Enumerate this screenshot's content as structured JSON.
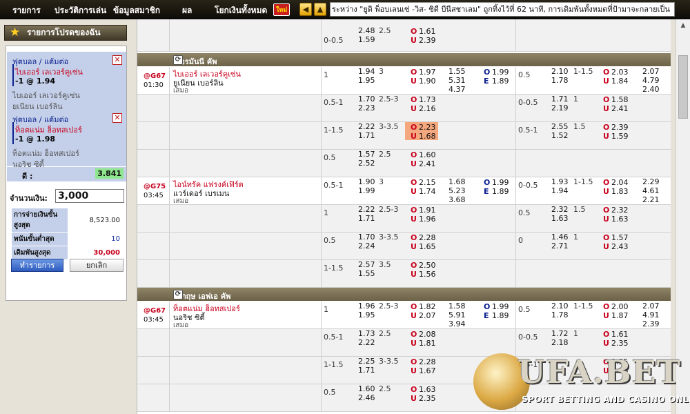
{
  "nav": {
    "items": [
      "รายการ",
      "ประวัติการเล่น",
      "ข้อมูลสมาชิก",
      "ผล",
      "โยกเงินทั้งหมด"
    ],
    "new_badge": "ใหม่",
    "marquee": "ระหว่าง \"ยูดิ พ็อบเลนเซ่ -วิส- ซิดี บีนีสชาเลม\" ถูกทิ้งไว้ที่ 62 นาที, การเดิมพันทั้งหมดที่ป้ามาจะกลายเป็น"
  },
  "slip": {
    "title": "รายการโปรดของฉัน",
    "bets": [
      {
        "type": "ฟุตบอล / แต้มต่อ",
        "pick": "ไบเออร์ เลเวอร์คูเซ่น",
        "line": "-1 @ 1.94",
        "home": "ไบเออร์ เลเวอร์คูเซ่น",
        "away": "ยูเนียน เบอร์ลิน"
      },
      {
        "type": "ฟุตบอล / แต้มต่อ",
        "pick": "ท็อตแน่ม ฮ็อทสเปอร์",
        "line": "-1 @ 1.98",
        "home": "ท็อตแน่ม ฮ็อทสเปอร์",
        "away": "นอริช ซิตี้"
      }
    ],
    "odds_label": "ดี :",
    "odds_value": "3.841",
    "stake_label": "จำนวนเงิน:",
    "stake_value": "3,000",
    "limits": [
      {
        "label": "การจ่ายเงินขั้นสูงสุด",
        "value": "8,523.00"
      },
      {
        "label": "พนันขั้นต่ำสุด",
        "value": "10"
      },
      {
        "label": "เดิมพันสูงสุด",
        "value": "30,000"
      }
    ],
    "place_label": "ทำรายการ",
    "cancel_label": "ยกเลิก"
  },
  "top_partial": {
    "hdp": "0-0.5",
    "h1": "2.48",
    "h2": "1.59",
    "ou": "2.5",
    "o": "1.61",
    "u": "2.39"
  },
  "leagues": [
    {
      "name": "เยอรมันนี คัพ",
      "matches": [
        {
          "code": "@G67",
          "time": "01:30",
          "home": "ไบเออร์ เลเวอร์คูเซ่น",
          "away": "ยูเนียน เบอร์ลิน",
          "draw": "เสมอ",
          "rows": [
            {
              "hdp": "1",
              "h1": "1.94",
              "h2": "1.95",
              "ou": "3",
              "o": "1.97",
              "u": "1.90",
              "x1": [
                "1.55",
                "5.31",
                "4.37"
              ],
              "oe": [
                "1.99",
                "1.89"
              ],
              "hhdp": "0.5",
              "hh1": "2.10",
              "hh2": "1.78",
              "hou": "1-1.5",
              "ho": "2.03",
              "hu": "1.84",
              "hx": [
                "2.07",
                "4.79",
                "2.40"
              ]
            },
            {
              "hdp": "0.5-1",
              "h1": "1.70",
              "h2": "2.23",
              "ou": "2.5-3",
              "o": "1.73",
              "u": "2.16",
              "hhdp": "0-0.5",
              "hh1": "1.71",
              "hh2": "2.19",
              "hou": "1",
              "ho": "1.58",
              "hu": "2.41"
            },
            {
              "hdp": "1-1.5",
              "h1": "2.22",
              "h2": "1.71",
              "ou": "3-3.5",
              "o": "2.23",
              "u": "1.68",
              "hl": true,
              "hhdp": "0.5-1",
              "hh1": "2.55",
              "hh2": "1.52",
              "hou": "1.5",
              "ho": "2.39",
              "hu": "1.59"
            },
            {
              "hdp": "0.5",
              "h1": "1.57",
              "h2": "2.52",
              "ou": "2.5",
              "o": "1.60",
              "u": "2.41"
            }
          ]
        },
        {
          "code": "@G75",
          "time": "03:45",
          "home": "ไอน์ทรัค แฟรงค์เฟิร์ต",
          "away": "แวร์เดอร์ เบรเมน",
          "draw": "เสมอ",
          "rows": [
            {
              "hdp": "0.5-1",
              "h1": "1.90",
              "h2": "1.99",
              "ou": "3",
              "o": "2.15",
              "u": "1.74",
              "x1": [
                "1.68",
                "5.23",
                "3.68"
              ],
              "oe": [
                "1.99",
                "1.89"
              ],
              "hhdp": "0-0.5",
              "hh1": "1.93",
              "hh2": "1.94",
              "hou": "1-1.5",
              "ho": "2.04",
              "hu": "1.83",
              "hx": [
                "2.29",
                "4.61",
                "2.21"
              ]
            },
            {
              "hdp": "1",
              "h1": "2.22",
              "h2": "1.71",
              "ou": "2.5-3",
              "o": "1.91",
              "u": "1.96",
              "hhdp": "0.5",
              "hh1": "2.32",
              "hh2": "1.63",
              "hou": "1.5",
              "ho": "2.32",
              "hu": "1.63"
            },
            {
              "hdp": "0.5",
              "h1": "1.70",
              "h2": "2.24",
              "ou": "3-3.5",
              "o": "2.28",
              "u": "1.65",
              "hhdp": "0",
              "hh1": "1.46",
              "hh2": "2.71",
              "hou": "1",
              "ho": "1.57",
              "hu": "2.43"
            },
            {
              "hdp": "1-1.5",
              "h1": "2.57",
              "h2": "1.55",
              "ou": "3.5",
              "o": "2.50",
              "u": "1.56"
            }
          ]
        }
      ]
    },
    {
      "name": "อังกฤษ เอฟเอ คัพ",
      "matches": [
        {
          "code": "@G67",
          "time": "03:45",
          "home": "ท็อตแน่ม ฮ็อทสเปอร์",
          "away": "นอริช ซิตี้",
          "draw": "เสมอ",
          "rows": [
            {
              "hdp": "1",
              "h1": "1.96",
              "h2": "1.95",
              "ou": "2.5-3",
              "o": "1.82",
              "u": "2.07",
              "x1": [
                "1.58",
                "5.91",
                "3.94"
              ],
              "oe": [
                "1.99",
                "1.89"
              ],
              "hhdp": "0.5",
              "hh1": "2.10",
              "hh2": "1.78",
              "hou": "1-1.5",
              "ho": "2.00",
              "hu": "1.87",
              "hx": [
                "2.07",
                "4.91",
                "2.39"
              ]
            },
            {
              "hdp": "0.5-1",
              "h1": "1.73",
              "h2": "2.22",
              "ou": "2.5",
              "o": "2.08",
              "u": "1.81",
              "hhdp": "0-0.5",
              "hh1": "1.72",
              "hh2": "2.18",
              "hou": "1",
              "ho": "1.61",
              "hu": "2.35"
            },
            {
              "hdp": "1-1.5",
              "h1": "2.25",
              "h2": "1.71",
              "ou": "3-3.5",
              "o": "2.28",
              "u": "1.67",
              "hhdp": "0.5-1",
              "hh1": "",
              "hh2": "",
              "hou": "",
              "ho": "2.35",
              "hu": "1.58"
            },
            {
              "hdp": "0.5",
              "h1": "1.60",
              "h2": "2.46",
              "ou": "2.5",
              "o": "1.63",
              "u": "2.35"
            }
          ]
        }
      ]
    }
  ],
  "logo": {
    "text": "UFA.BET",
    "sub": "SPORT BETTING AND CASINO ONLINE"
  }
}
